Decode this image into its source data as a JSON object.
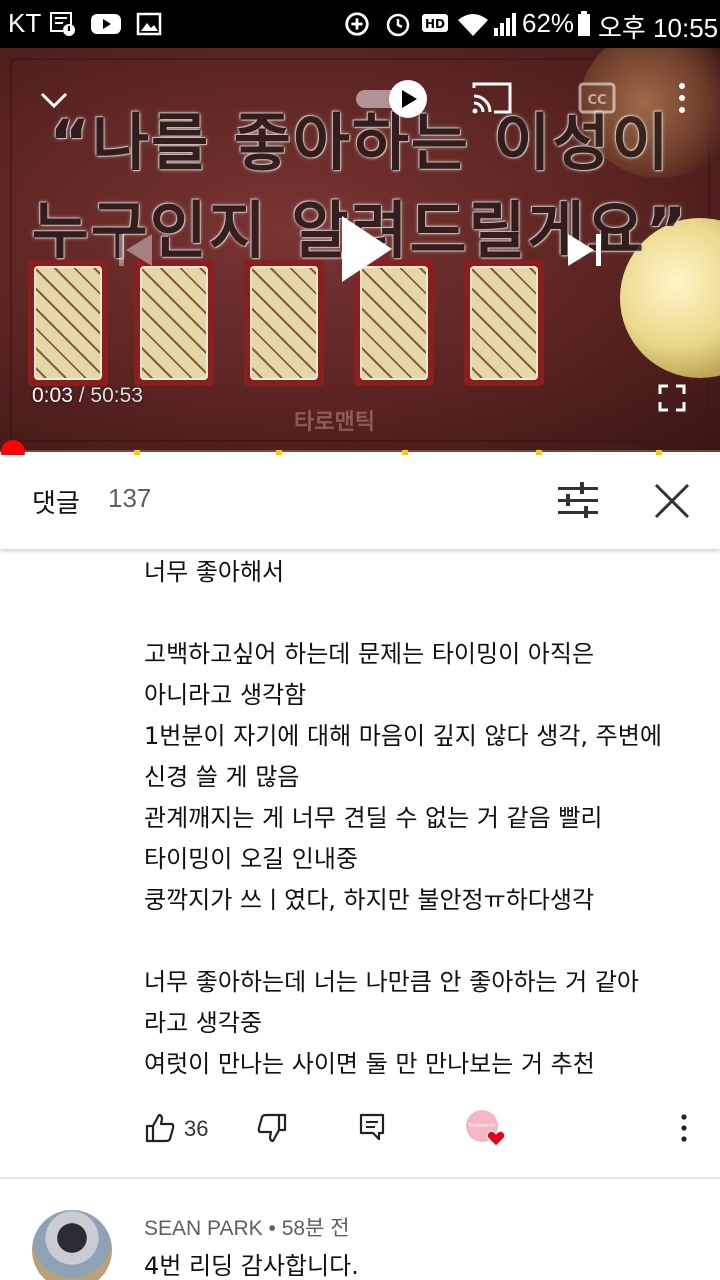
{
  "status_bar": {
    "carrier": "KT",
    "battery": "62%",
    "time": "오후 10:55"
  },
  "video": {
    "title_line1": "“나를 좋아하는 이성이",
    "title_line2": "누구인지 알려드릴게요”",
    "watermark": "타로맨틱",
    "current_time": "0:03",
    "separator": " / ",
    "duration": "50:53",
    "progress_fraction": 0.001,
    "progress_color": "#ff0000",
    "icons": [
      "chevron-down-icon",
      "autoplay-toggle-icon",
      "cast-icon",
      "captions-icon",
      "more-vert-icon",
      "previous-icon",
      "play-icon",
      "next-icon",
      "fullscreen-icon"
    ]
  },
  "comments": {
    "label": "댓글",
    "count": "137",
    "sort_icon": "sort-icon",
    "close_icon": "close-icon"
  },
  "comment": {
    "lines": [
      "너무 좋아해서",
      "",
      "고백하고싶어 하는데 문제는 타이밍이 아직은",
      "아니라고 생각함",
      "1번분이 자기에 대해 마음이 깊지 않다 생각, 주변에",
      "신경 쓸 게 많음",
      "관계깨지는 게 너무 견딜 수 없는 거 같음 빨리",
      "타이밍이 오길 인내중",
      "쿵깍지가 쓰ㅣ였다, 하지만 불안정ㅠ하다생각",
      "",
      "너무 좋아하는데 너는 나만큼 안 좋아하는 거 같아",
      "라고 생각중",
      "여럿이 만나는 사이면 둘 만 만나보는 거 추천"
    ],
    "likes": "36",
    "creator_avatar_text": "Taromantic",
    "heart_color": "#e8001c"
  },
  "next_comment": {
    "author": "SEAN PARK",
    "bullet": " • ",
    "age": "58분 전",
    "text": "4번 리딩 감사합니다."
  }
}
